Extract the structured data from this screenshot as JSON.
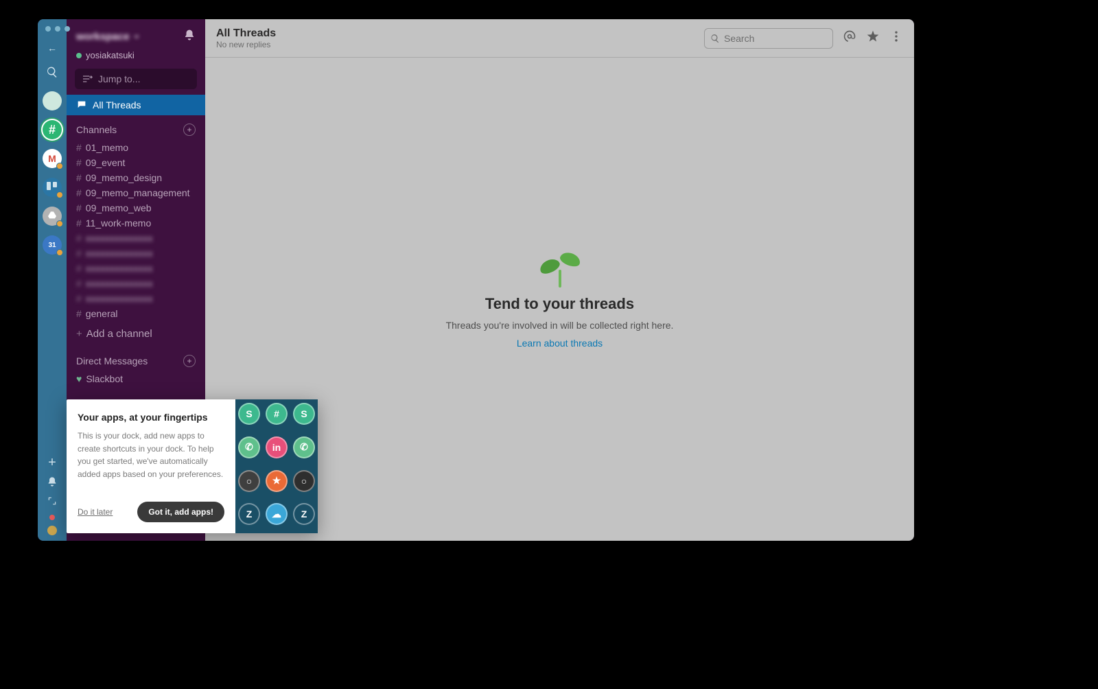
{
  "traffic_lights": {
    "color": "#7fb5cc"
  },
  "rail": {
    "icons": {
      "back": "←",
      "search": "search-icon",
      "apps": [
        {
          "name": "workspace-1",
          "bg": "#cfe8de"
        },
        {
          "name": "slack",
          "bg": "#2bb673",
          "active": true
        },
        {
          "name": "gmail",
          "bg": "#ffffff",
          "badge": true,
          "label": "M"
        },
        {
          "name": "trello",
          "bg": "#2b76a5",
          "badge": true
        },
        {
          "name": "google-drive",
          "bg": "#b3b3b3",
          "badge": true
        },
        {
          "name": "calendar",
          "bg": "#3b78c5",
          "badge": true,
          "label": "31"
        }
      ]
    },
    "bottom": {
      "plus": "+",
      "bell": "bell",
      "expand": "expand"
    }
  },
  "sidebar": {
    "workspace_name": "workspace",
    "user": "yosiakatsuki",
    "jump_to": "Jump to...",
    "all_threads": "All Threads",
    "channels_label": "Channels",
    "channels": [
      {
        "name": "01_memo"
      },
      {
        "name": "09_event"
      },
      {
        "name": "09_memo_design"
      },
      {
        "name": "09_memo_management"
      },
      {
        "name": "09_memo_web"
      },
      {
        "name": "11_work-memo"
      },
      {
        "name": "blurred",
        "blurred": true
      },
      {
        "name": "blurred",
        "blurred": true
      },
      {
        "name": "blurred",
        "blurred": true
      },
      {
        "name": "blurred",
        "blurred": true
      },
      {
        "name": "blurred",
        "blurred": true
      },
      {
        "name": "general"
      }
    ],
    "add_channel": "Add a channel",
    "dm_label": "Direct Messages",
    "dms": [
      {
        "name": "Slackbot"
      }
    ]
  },
  "header": {
    "title": "All Threads",
    "subtitle": "No new replies",
    "search_placeholder": "Search"
  },
  "empty": {
    "title": "Tend to your threads",
    "body": "Threads you're involved in will be collected right here.",
    "link": "Learn about threads"
  },
  "popover": {
    "title": "Your apps, at your fingertips",
    "body": "This is your dock, add new apps to create shortcuts in your dock. To help you get started, we've automatically added apps based on your preferences.",
    "later": "Do it later",
    "cta": "Got it, add apps!"
  }
}
